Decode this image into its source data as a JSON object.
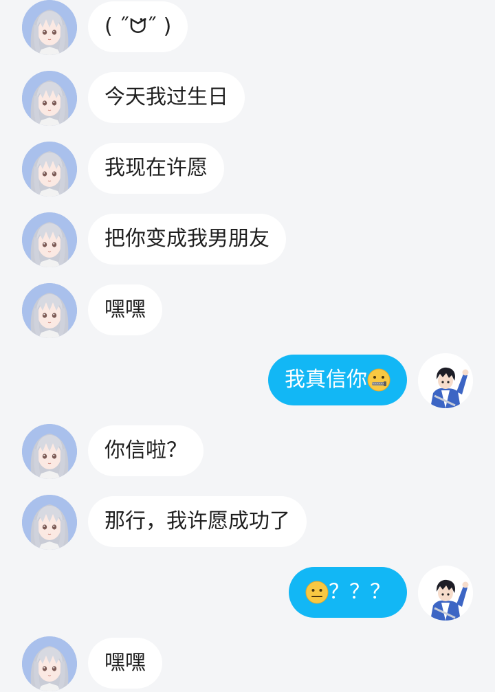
{
  "messages": [
    {
      "side": "left",
      "text": "( ˝ᗢ̈˝ )"
    },
    {
      "side": "left",
      "text": "今天我过生日"
    },
    {
      "side": "left",
      "text": "我现在许愿"
    },
    {
      "side": "left",
      "text": "把你变成我男朋友"
    },
    {
      "side": "left",
      "text": "嘿嘿"
    },
    {
      "side": "right",
      "text": "我真信你",
      "emoji_after": "zipper-mouth-emoji"
    },
    {
      "side": "left",
      "text": "你信啦？"
    },
    {
      "side": "left",
      "text": "那行，我许愿成功了"
    },
    {
      "side": "right",
      "text": "？？？",
      "emoji_before": "neutral-face-emoji"
    },
    {
      "side": "left",
      "text": "嘿嘿"
    }
  ],
  "colors": {
    "background": "#f4f5f7",
    "incoming_bubble": "#ffffff",
    "outgoing_bubble": "#12b7f5",
    "incoming_text": "#1f1f1f",
    "outgoing_text": "#ffffff"
  },
  "avatars": {
    "contact": "anime-girl-avatar",
    "self": "anime-boy-avatar"
  }
}
